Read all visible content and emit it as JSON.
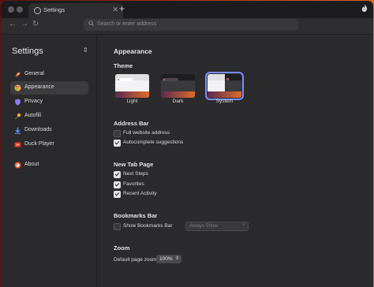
{
  "tab": {
    "title": "Settings",
    "close": "✕",
    "new_tab": "+"
  },
  "nav": {
    "back": "←",
    "forward": "→",
    "reload": "↻",
    "address_placeholder": "Search or enter address"
  },
  "sidebar": {
    "title": "Settings",
    "items": [
      {
        "label": "General",
        "icon": "rocket-icon",
        "color": "#e0662a"
      },
      {
        "label": "Appearance",
        "icon": "palette-icon",
        "color": "#f0b030"
      },
      {
        "label": "Privacy",
        "icon": "shield-icon",
        "color": "#8d7cf0"
      },
      {
        "label": "Autofill",
        "icon": "key-icon",
        "color": "#e8b230"
      },
      {
        "label": "Downloads",
        "icon": "download-icon",
        "color": "#5b8cff"
      },
      {
        "label": "Duck Player",
        "icon": "video-icon",
        "color": "#e23d2b"
      },
      {
        "label": "About",
        "icon": "duck-logo-icon",
        "color": "#de5833"
      }
    ],
    "active_index": 1
  },
  "main": {
    "heading": "Appearance",
    "theme": {
      "heading": "Theme",
      "options": [
        "Light",
        "Dark",
        "System"
      ],
      "selected": "System"
    },
    "address_bar": {
      "heading": "Address Bar",
      "options": [
        {
          "label": "Full website address",
          "checked": false
        },
        {
          "label": "Autocomplete suggestions",
          "checked": true
        }
      ]
    },
    "new_tab_page": {
      "heading": "New Tab Page",
      "options": [
        {
          "label": "Next Steps",
          "checked": true
        },
        {
          "label": "Favorites",
          "checked": true
        },
        {
          "label": "Recent Activity",
          "checked": true
        }
      ]
    },
    "bookmarks_bar": {
      "heading": "Bookmarks Bar",
      "show_label": "Show Bookmarks Bar",
      "checked": false,
      "select_value": "Always Show"
    },
    "zoom": {
      "heading": "Zoom",
      "label": "Default page zoom",
      "value": "100%"
    }
  },
  "colors": {
    "accent": "#7b8cff",
    "window_bg": "#2b2b2d",
    "desktop": "#a8321c"
  }
}
